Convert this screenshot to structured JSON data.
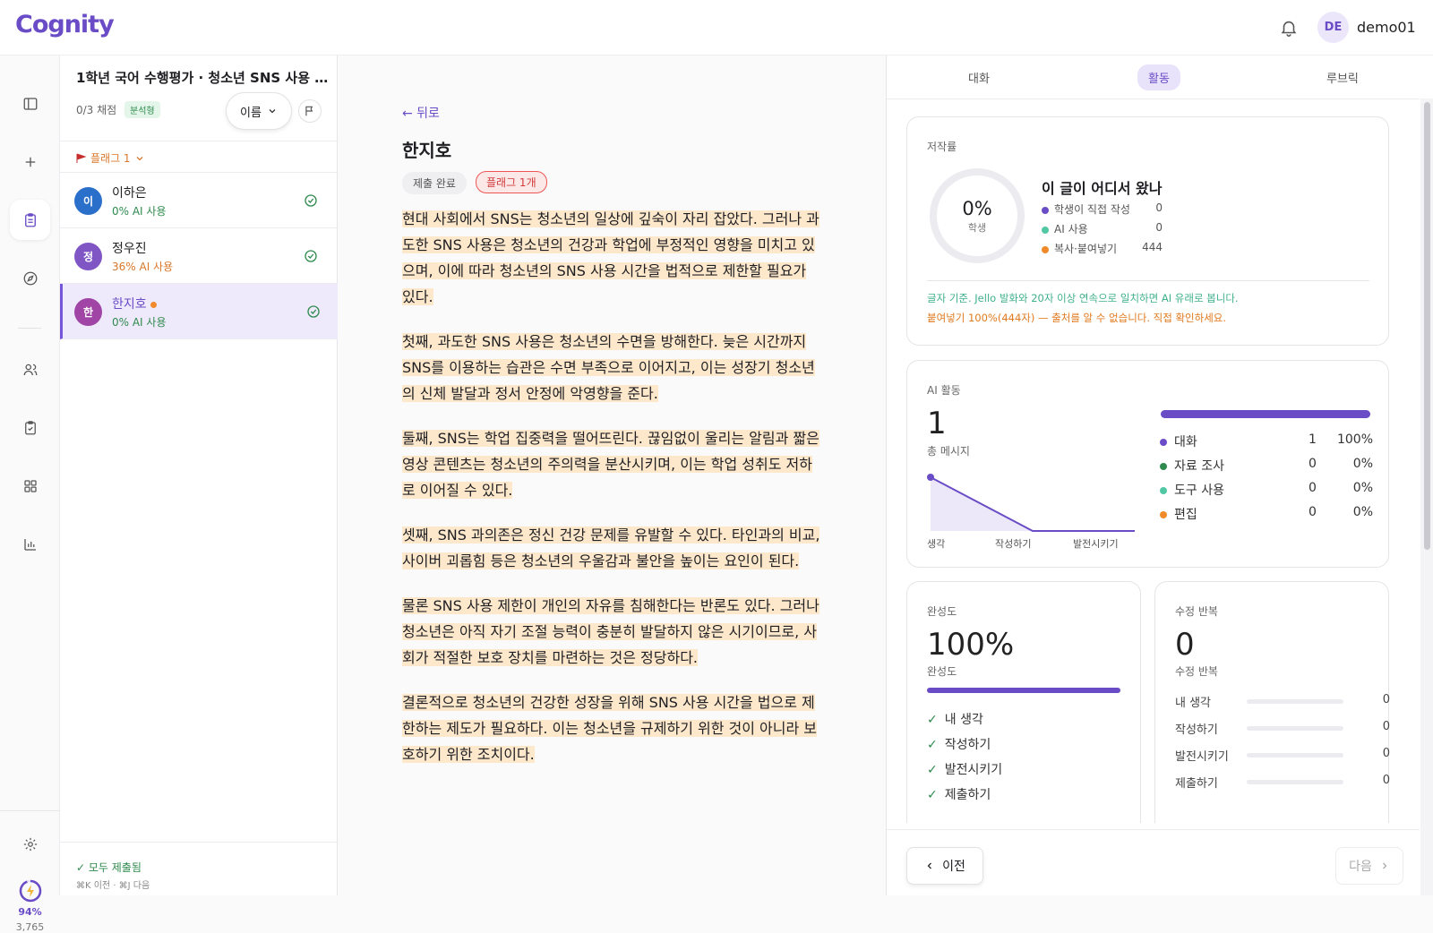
{
  "app": {
    "logo": "Cognity",
    "user_initials": "DE",
    "username": "demo01"
  },
  "rail": {
    "energy_percent": "94%",
    "energy_count": "3,765"
  },
  "assignment": {
    "title": "1학년 국어 수행평가 · 청소년 SNS 사용 시...",
    "graded": "0/3 채점",
    "type_badge": "분석형",
    "sort_label": "이름",
    "flag_filter": "플래그 1"
  },
  "students": [
    {
      "initial": "이",
      "name": "이하은",
      "ai_usage": "0% AI 사용",
      "color": "#2a6fc9",
      "ai_color": "#2f8a4e"
    },
    {
      "initial": "정",
      "name": "정우진",
      "ai_usage": "36% AI 사용",
      "color": "#7f56c4",
      "ai_color": "#d9772a"
    },
    {
      "initial": "한",
      "name": "한지호",
      "ai_usage": "0% AI 사용",
      "color": "#a044a5",
      "ai_color": "#2f8a4e"
    }
  ],
  "list_footer": {
    "status": "✓ 모두 제출됨",
    "shortcut": "⌘K 이전 · ⌘J 다음"
  },
  "document": {
    "back_label": "← 뒤로",
    "student_name": "한지호",
    "status_badge": "제출 완료",
    "flag_badge": "플래그 1개",
    "paragraphs": [
      "현대 사회에서 SNS는 청소년의 일상에 깊숙이 자리 잡았다. 그러나 과도한 SNS 사용은 청소년의 건강과 학업에 부정적인 영향을 미치고 있으며, 이에 따라 청소년의 SNS 사용 시간을 법적으로 제한할 필요가 있다.",
      "첫째, 과도한 SNS 사용은 청소년의 수면을 방해한다. 늦은 시간까지 SNS를 이용하는 습관은 수면 부족으로 이어지고, 이는 성장기 청소년의 신체 발달과 정서 안정에 악영향을 준다.",
      "둘째, SNS는 학업 집중력을 떨어뜨린다. 끊임없이 울리는 알림과 짧은 영상 콘텐츠는 청소년의 주의력을 분산시키며, 이는 학업 성취도 저하로 이어질 수 있다.",
      "셋째, SNS 과의존은 정신 건강 문제를 유발할 수 있다. 타인과의 비교, 사이버 괴롭힘 등은 청소년의 우울감과 불안을 높이는 요인이 된다.",
      "물론 SNS 사용 제한이 개인의 자유를 침해한다는 반론도 있다. 그러나 청소년은 아직 자기 조절 능력이 충분히 발달하지 않은 시기이므로, 사회가 적절한 보호 장치를 마련하는 것은 정당하다.",
      "결론적으로 청소년의 건강한 성장을 위해 SNS 사용 시간을 법으로 제한하는 제도가 필요하다. 이는 청소년을 규제하기 위한 것이 아니라 보호하기 위한 조치이다."
    ]
  },
  "tabs": [
    "대화",
    "활동",
    "루브릭"
  ],
  "authorship": {
    "title": "저작률",
    "percent": "0%",
    "percent_label": "학생",
    "heading": "이 글이 어디서 왔나",
    "rows": [
      {
        "label": "학생이 직접 작성",
        "value": "0",
        "color": "#6a4cc7"
      },
      {
        "label": "AI 사용",
        "value": "0",
        "color": "#52c7a3"
      },
      {
        "label": "복사·붙여넣기",
        "value": "444",
        "color": "#f08a2a"
      }
    ],
    "note1": "글자 기준. Jello 발화와 20자 이상 연속으로 일치하면 AI 유래로 봅니다.",
    "note2": "붙여넣기 100%(444자) — 출처를 알 수 없습니다. 직접 확인하세요."
  },
  "ai_activity": {
    "title": "AI 활동",
    "total": "1",
    "total_label": "총 메시지",
    "bar_fill_fraction": 1.0,
    "legend": [
      {
        "label": "대화",
        "count": "1",
        "pct": "100%",
        "color": "#6a4cc7"
      },
      {
        "label": "자료 조사",
        "count": "0",
        "pct": "0%",
        "color": "#2f8a4e"
      },
      {
        "label": "도구 사용",
        "count": "0",
        "pct": "0%",
        "color": "#52c7a3"
      },
      {
        "label": "편집",
        "count": "0",
        "pct": "0%",
        "color": "#f08a2a"
      }
    ]
  },
  "chart_data": {
    "type": "area",
    "categories": [
      "생각",
      "작성하기",
      "발전시키기"
    ],
    "values": [
      1,
      0,
      0
    ],
    "title": "",
    "xlabel": "",
    "ylabel": ""
  },
  "completion": {
    "title": "완성도",
    "value": "100%",
    "label": "완성도",
    "fraction": 1.0,
    "steps": [
      "내 생각",
      "작성하기",
      "발전시키기",
      "제출하기"
    ]
  },
  "revisions": {
    "title": "수정 반복",
    "value": "0",
    "label": "수정 반복",
    "rows": [
      {
        "label": "내 생각",
        "value": "0"
      },
      {
        "label": "작성하기",
        "value": "0"
      },
      {
        "label": "발전시키기",
        "value": "0"
      },
      {
        "label": "제출하기",
        "value": "0"
      }
    ]
  },
  "nav": {
    "prev": "이전",
    "next": "다음"
  }
}
